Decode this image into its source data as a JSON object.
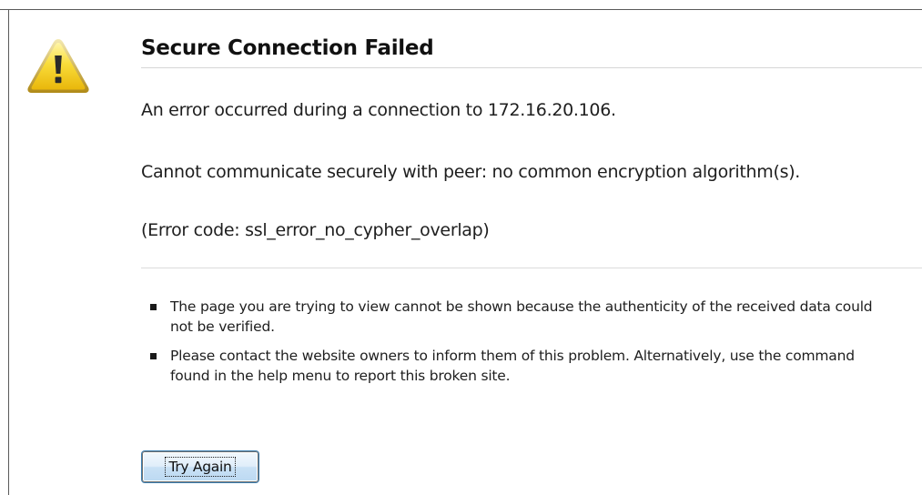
{
  "error_page": {
    "title": "Secure Connection Failed",
    "description": "An error occurred during a connection to 172.16.20.106.",
    "detail": "Cannot communicate securely with peer: no common encryption algorithm(s).",
    "error_code_line": "(Error code: ssl_error_no_cypher_overlap)",
    "icon": "warning-triangle-icon",
    "bullets": [
      "The page you are trying to view cannot be shown because the authenticity of the received data could not be verified.",
      "Please contact the website owners to inform them of this problem. Alternatively, use the command found in the help menu to report this broken site."
    ],
    "try_again_label": "Try Again"
  },
  "colors": {
    "icon_fill": "#f5d21c",
    "icon_border": "#b88f00",
    "button_focus": "#3c7fb1"
  }
}
